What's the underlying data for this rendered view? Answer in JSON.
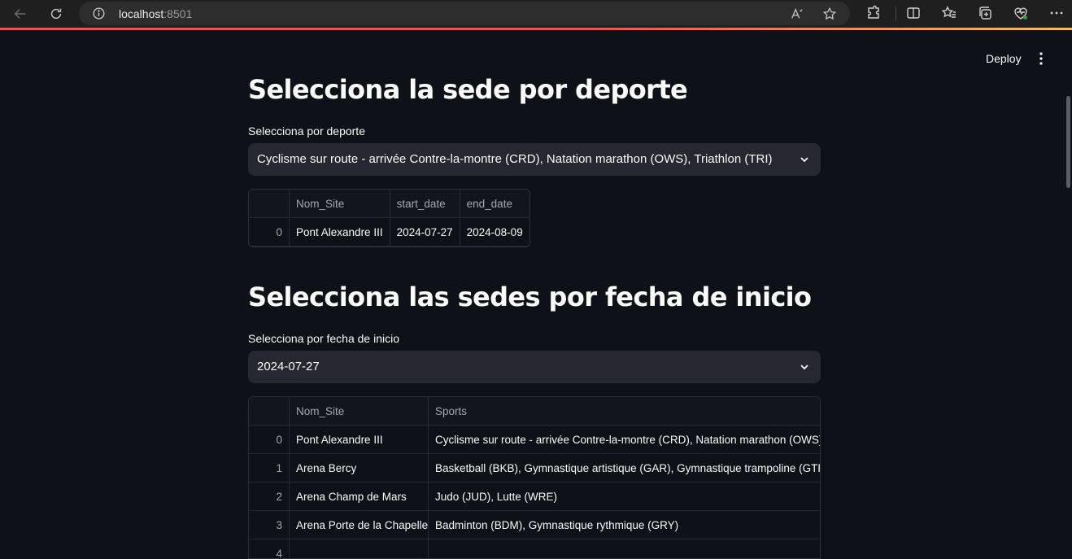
{
  "browser": {
    "url_host": "localhost",
    "url_port": ":8501"
  },
  "header": {
    "deploy_label": "Deploy"
  },
  "section1": {
    "title": "Selecciona la sede por deporte",
    "select_label": "Selecciona por deporte",
    "select_value": "Cyclisme sur route - arrivée Contre-la-montre (CRD), Natation marathon (OWS), Triathlon (TRI)",
    "table": {
      "columns": [
        "",
        "Nom_Site",
        "start_date",
        "end_date"
      ],
      "rows": [
        [
          "0",
          "Pont Alexandre III",
          "2024-07-27",
          "2024-08-09"
        ]
      ]
    }
  },
  "section2": {
    "title": "Selecciona las sedes por fecha de inicio",
    "select_label": "Selecciona por fecha de inicio",
    "select_value": "2024-07-27",
    "table": {
      "columns": [
        "",
        "Nom_Site",
        "Sports"
      ],
      "rows": [
        [
          "0",
          "Pont Alexandre III",
          "Cyclisme sur route - arrivée Contre-la-montre (CRD), Natation marathon (OWS), T"
        ],
        [
          "1",
          "Arena Bercy",
          "Basketball (BKB), Gymnastique artistique (GAR), Gymnastique trampoline (GTR)"
        ],
        [
          "2",
          "Arena Champ de Mars",
          "Judo (JUD), Lutte (WRE)"
        ],
        [
          "3",
          "Arena Porte de la Chapelle",
          "Badminton (BDM), Gymnastique rythmique (GRY)"
        ],
        [
          "4",
          "",
          ""
        ]
      ]
    }
  }
}
